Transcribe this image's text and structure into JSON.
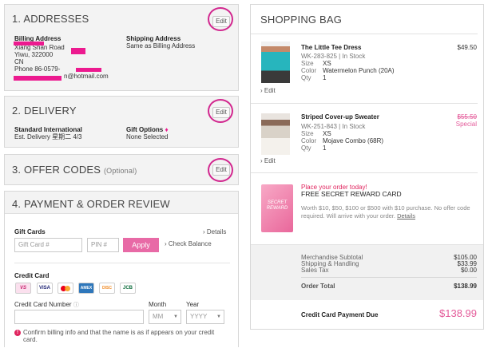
{
  "addresses": {
    "title": "1. ADDRESSES",
    "edit": "Edit",
    "billing_label": "Billing Address",
    "billing_lines": [
      "Xiang Shan Road",
      "Yiwu, 322000",
      "CN",
      "Phone 86-0579-",
      "n@hotmail.com"
    ],
    "shipping_label": "Shipping Address",
    "shipping_value": "Same as Billing Address"
  },
  "delivery": {
    "title": "2. DELIVERY",
    "edit": "Edit",
    "method_label": "Standard International",
    "method_est": "Est. Delivery 星期二 4/3",
    "gift_label": "Gift Options",
    "gift_value": "None Selected"
  },
  "offer": {
    "title": "3. OFFER CODES",
    "optional": "(Optional)",
    "edit": "Edit"
  },
  "payment": {
    "title": "4. PAYMENT & ORDER REVIEW",
    "gift_cards_label": "Gift Cards",
    "details_link": "› Details",
    "gift_card_placeholder": "Gift Card #",
    "pin_placeholder": "PIN #",
    "apply_label": "Apply",
    "check_balance": "› Check Balance",
    "credit_card_label": "Credit Card",
    "card_icons": [
      "VS",
      "VISA",
      "MC",
      "AMEX",
      "DISC",
      "JCB"
    ],
    "cc_number_label": "Credit Card Number",
    "month_label": "Month",
    "year_label": "Year",
    "month_placeholder": "MM",
    "year_placeholder": "YYYY",
    "confirm_text": "Confirm billing info and that the name is as if appears on your credit card."
  },
  "bag": {
    "title": "SHOPPING BAG",
    "items": [
      {
        "name": "The Little Tee Dress",
        "price": "$49.50",
        "sku": "WK-283-825 | In Stock",
        "size_label": "Size",
        "size": "XS",
        "color_label": "Color",
        "color": "Watermelon Punch (20A)",
        "qty_label": "Qty",
        "qty": "1",
        "edit": "› Edit"
      },
      {
        "name": "Striped Cover-up Sweater",
        "price": "$55.50",
        "special": "Special",
        "sku": "WK-251-843 | In Stock",
        "size_label": "Size",
        "size": "XS",
        "color_label": "Color",
        "color": "Mojave Combo (68R)",
        "qty_label": "Qty",
        "qty": "1",
        "edit": "› Edit"
      }
    ],
    "promo": {
      "card_text": "SECRET REWARD",
      "headline": "Place your order today!",
      "title": "FREE SECRET REWARD CARD",
      "body": "Worth $10, $50, $100 or $500 with $10 purchase. No offer code required. Will arrive with your order.",
      "details": "Details"
    },
    "summary": {
      "merch_label": "Merchandise Subtotal",
      "merch": "$105.00",
      "ship_label": "Shipping & Handling",
      "ship": "$33.99",
      "tax_label": "Sales Tax",
      "tax": "$0.00",
      "total_label": "Order Total",
      "total": "$138.99",
      "due_label": "Credit Card Payment Due",
      "due": "$138.99"
    }
  },
  "colors": {
    "accent": "#ec1a8f",
    "apply": "#e86aa6",
    "panel_bg": "#f3f3f3"
  }
}
